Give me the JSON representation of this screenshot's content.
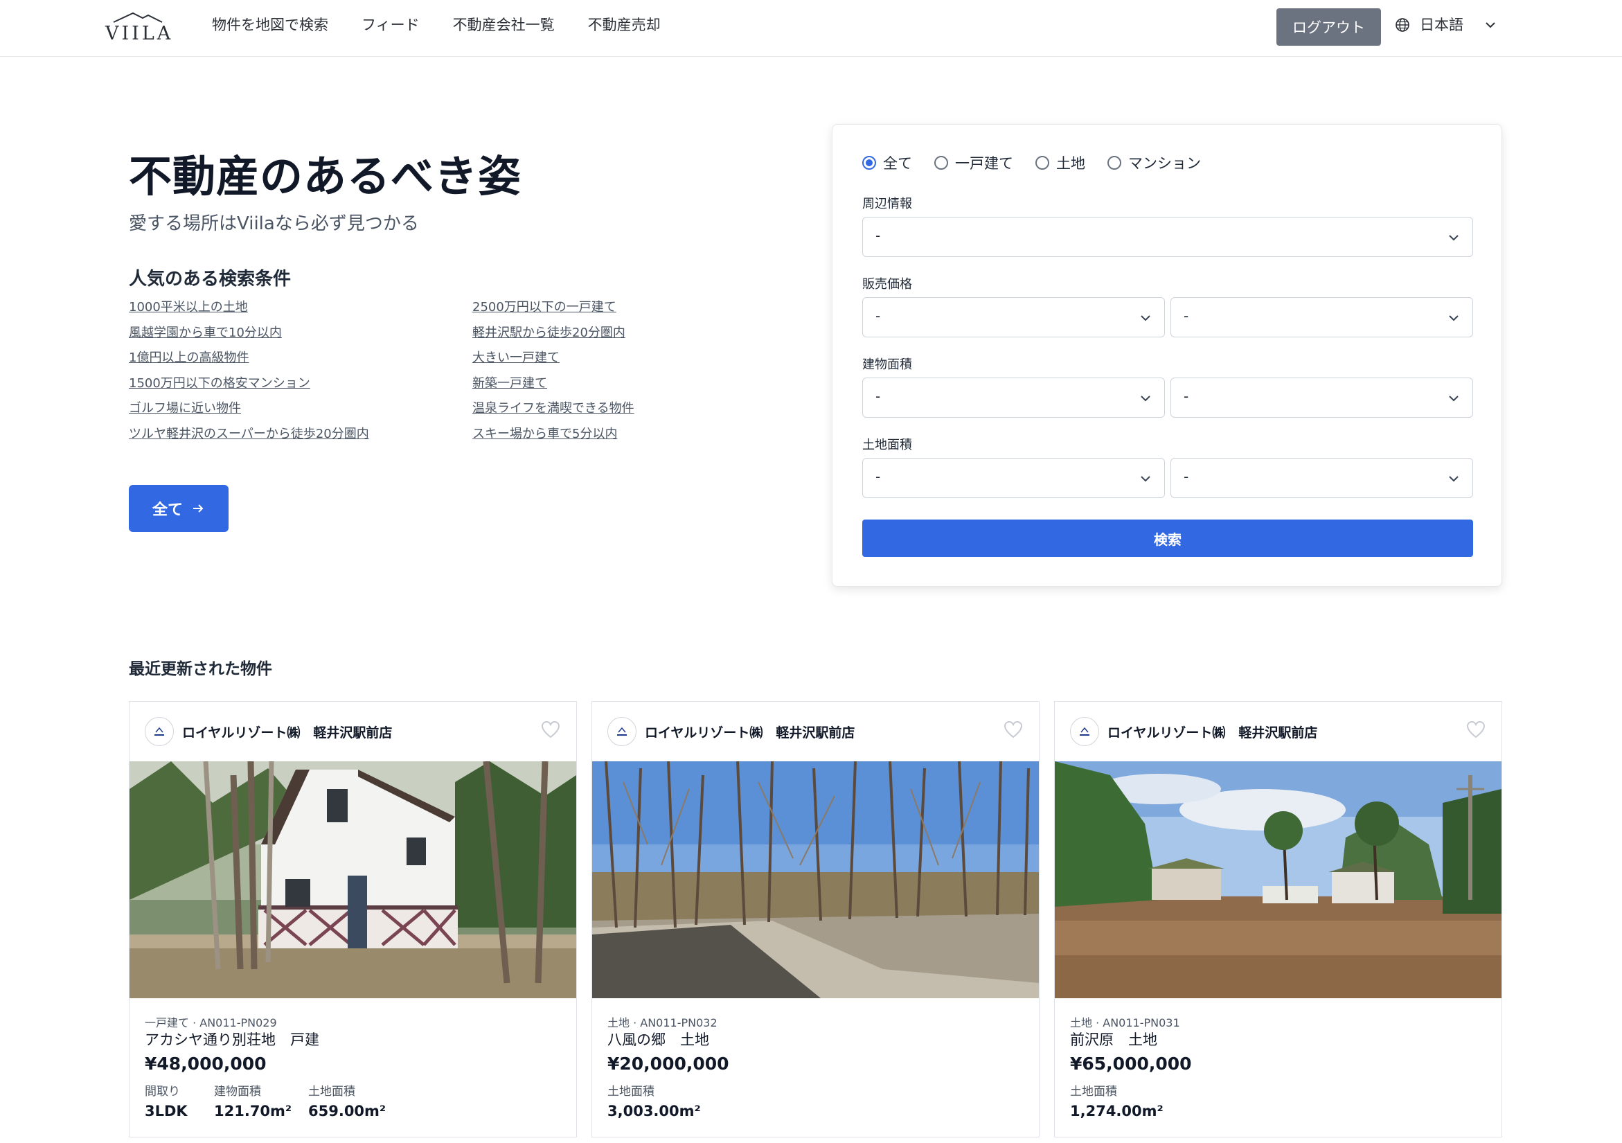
{
  "header": {
    "logo_text": "VIILA",
    "nav": [
      "物件を地図で検索",
      "フィード",
      "不動産会社一覧",
      "不動産売却"
    ],
    "logout_label": "ログアウト",
    "language": "日本語"
  },
  "hero": {
    "title": "不動産のあるべき姿",
    "subtitle": "愛する場所はViilaなら必ず見つかる",
    "popular_title": "人気のある検索条件",
    "popular_left": [
      "1000平米以上の土地",
      "風越学園から車で10分以内",
      "1億円以上の高級物件",
      "1500万円以下の格安マンション",
      "ゴルフ場に近い物件",
      "ツルヤ軽井沢のスーパーから徒歩20分圏内"
    ],
    "popular_right": [
      "2500万円以下の一戸建て",
      "軽井沢駅から徒歩20分圏内",
      "大きい一戸建て",
      "新築一戸建て",
      "温泉ライフを満喫できる物件",
      "スキー場から車で5分以内"
    ],
    "all_button": "全て"
  },
  "search": {
    "types": [
      "全て",
      "一戸建て",
      "土地",
      "マンション"
    ],
    "selected_type": "全て",
    "surroundings_label": "周辺情報",
    "price_label": "販売価格",
    "building_area_label": "建物面積",
    "land_area_label": "土地面積",
    "select_value": "-",
    "search_button": "検索"
  },
  "recent": {
    "title": "最近更新された物件",
    "cards": [
      {
        "agency": "ロイヤルリゾート㈱　軽井沢駅前店",
        "meta": "一戸建て · AN011-PN029",
        "name": "アカシヤ通り別荘地　戸建",
        "price": "¥48,000,000",
        "specs": [
          {
            "k": "間取り",
            "v": "3LDK"
          },
          {
            "k": "建物面積",
            "v": "121.70m²"
          },
          {
            "k": "土地面積",
            "v": "659.00m²"
          }
        ]
      },
      {
        "agency": "ロイヤルリゾート㈱　軽井沢駅前店",
        "meta": "土地 · AN011-PN032",
        "name": "八風の郷　土地",
        "price": "¥20,000,000",
        "specs": [
          {
            "k": "土地面積",
            "v": "3,003.00m²"
          }
        ]
      },
      {
        "agency": "ロイヤルリゾート㈱　軽井沢駅前店",
        "meta": "土地 · AN011-PN031",
        "name": "前沢原　土地",
        "price": "¥65,000,000",
        "specs": [
          {
            "k": "土地面積",
            "v": "1,274.00m²"
          }
        ]
      }
    ]
  },
  "colors": {
    "accent": "#3268e2",
    "logout_bg": "#6b7280"
  }
}
